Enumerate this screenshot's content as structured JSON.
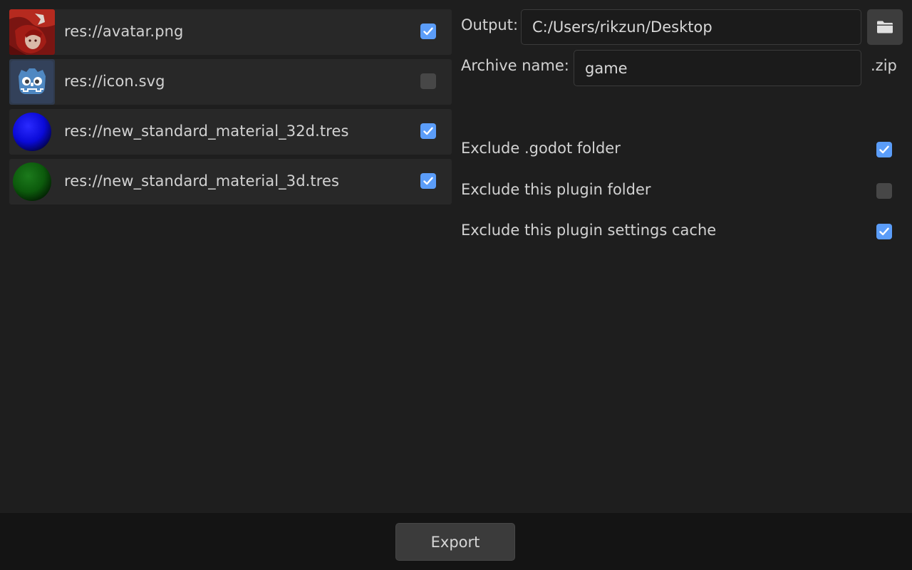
{
  "files": [
    {
      "path": "res://avatar.png",
      "checked": true,
      "thumb": "avatar-image"
    },
    {
      "path": "res://icon.svg",
      "checked": false,
      "thumb": "godot-logo-icon"
    },
    {
      "path": "res://new_standard_material_32d.tres",
      "checked": true,
      "thumb": "blue-material-sphere"
    },
    {
      "path": "res://new_standard_material_3d.tres",
      "checked": true,
      "thumb": "green-material-sphere"
    }
  ],
  "output": {
    "label": "Output:",
    "value": "C:/Users/rikzun/Desktop",
    "browse_icon": "folder-icon"
  },
  "archive": {
    "label": "Archive name:",
    "value": "game",
    "suffix": ".zip"
  },
  "options": [
    {
      "label": "Exclude .godot folder",
      "checked": true
    },
    {
      "label": "Exclude this plugin folder",
      "checked": false
    },
    {
      "label": "Exclude this plugin settings cache",
      "checked": true
    }
  ],
  "footer": {
    "export_label": "Export"
  },
  "colors": {
    "accent": "#5b9df9",
    "background": "#1e1e1e",
    "row": "#282828",
    "footer": "#141414"
  }
}
